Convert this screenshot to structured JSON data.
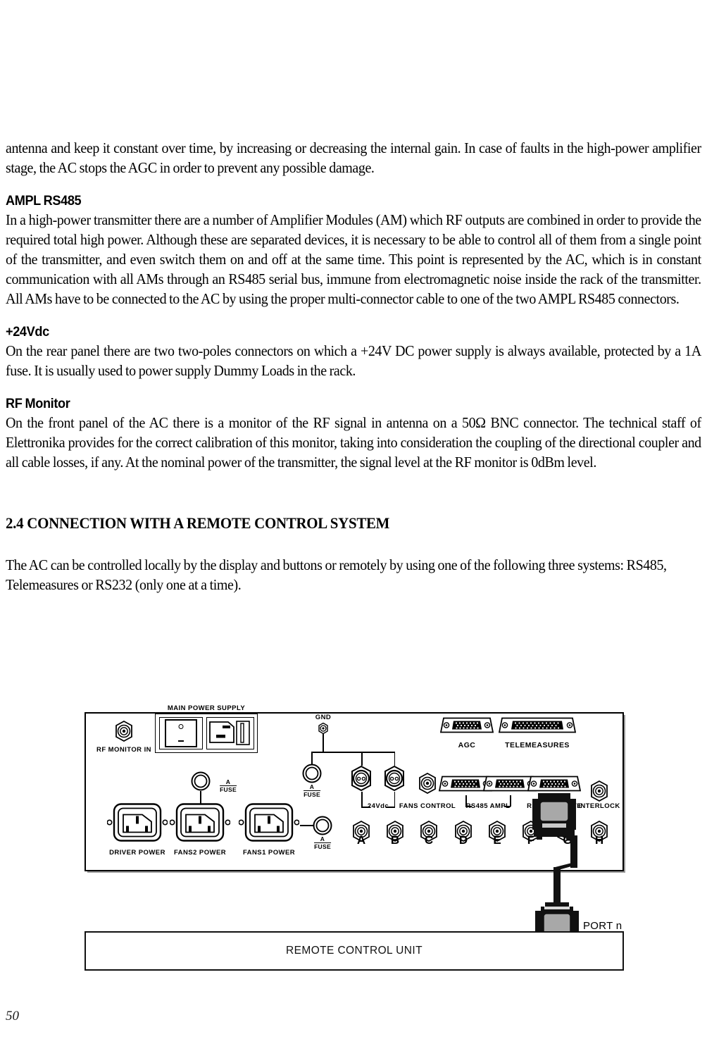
{
  "page": {
    "number": "50"
  },
  "body": {
    "para_1": "antenna and keep it constant over time, by increasing or decreasing the internal gain. In case of faults in the high-power amplifier stage, the AC stops the AGC in order to prevent any possible damage.",
    "heading_ampl": "AMPL RS485",
    "para_2": "In a high-power transmitter there are a number of Amplifier Modules (AM) which RF outputs are combined in order to provide the required total high power. Although these are separated devices, it is necessary to be able to control all of them from a single point of the transmitter, and even switch them on and off at the same time. This point is represented by the AC, which is in constant communication with all AMs through an RS485 serial bus, immune from electromagnetic noise inside the rack of the transmitter. All AMs have to be connected to the AC by using the proper multi-connector cable to one of the two AMPL RS485 connectors.",
    "heading_24vdc": "+24Vdc",
    "para_3": "On the rear panel there are two two-poles connectors on which a +24V DC power supply is always available, protected by a 1A fuse. It is usually used to power supply Dummy Loads in the rack.",
    "heading_rfmonitor": "RF Monitor",
    "para_4": "On the front panel of the AC there is a monitor of the RF signal in antenna on a 50Ω BNC connector. The technical staff of Elettronika provides for the correct calibration of this monitor, taking into consideration the coupling of the directional coupler and all cable losses, if any. At the nominal power of the transmitter, the signal level at the RF monitor is 0dBm level.",
    "heading_section": "2.4 CONNECTION WITH A REMOTE CONTROL SYSTEM",
    "para_5": "The AC can be controlled locally by the display and buttons or remotely by using one of the following three systems: RS485, Telemeasures or RS232 (only one at a time)."
  },
  "diagram": {
    "panel_labels": {
      "rf_monitor_in": "RF MONITOR IN",
      "main_power_supply": "MAIN POWER SUPPLY",
      "driver_power": "DRIVER POWER",
      "fans2_power": "FANS2 POWER",
      "fans1_power": "FANS1 POWER",
      "gnd": "GND",
      "fuse_a": "A",
      "fuse": "FUSE",
      "v24dc": "24Vdc",
      "fans_control": "FANS CONTROL",
      "rs485_ampl": "RS485 AMPL",
      "agc": "AGC",
      "telemeasures": "TELEMEASURES",
      "rs485_remote": "RS485 REMOTE",
      "interlock": "INTERLOCK"
    },
    "bnc_row": [
      "A",
      "B",
      "C",
      "D",
      "E",
      "F",
      "G",
      "H"
    ],
    "port_label": "PORT n",
    "remote_control_unit": "REMOTE CONTROL UNIT"
  }
}
